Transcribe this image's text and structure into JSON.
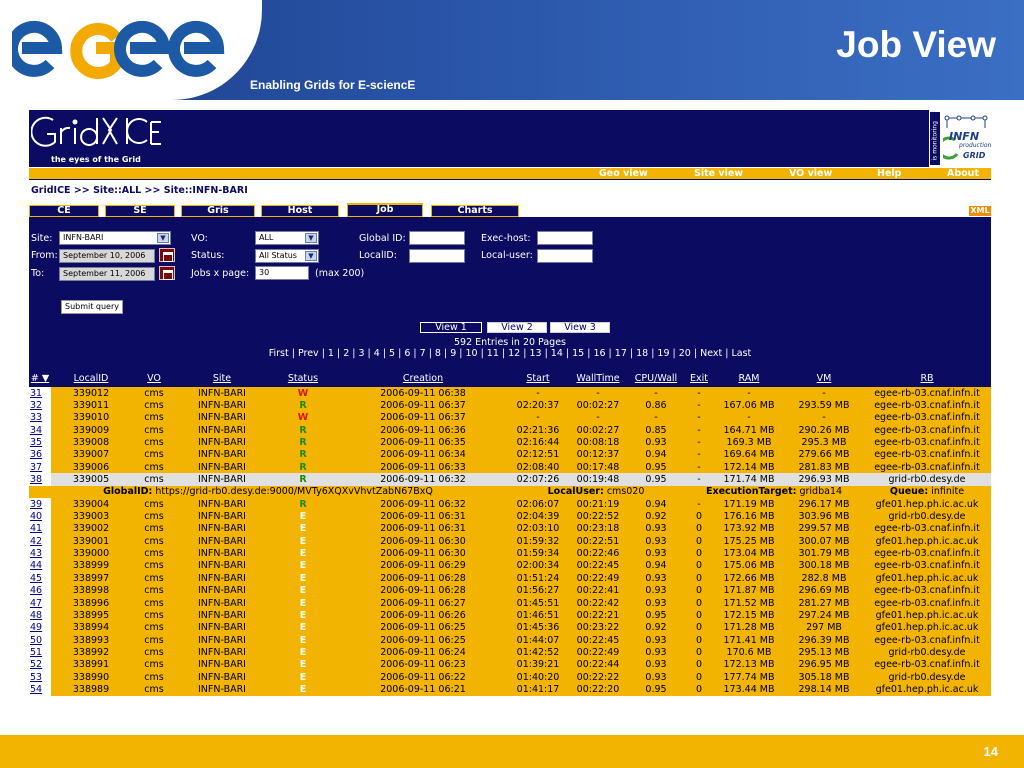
{
  "slide": {
    "title": "Job View",
    "subtitle": "Enabling Grids for E-sciencE",
    "page_number": "14",
    "logo_text": "egee",
    "colors": {
      "header_blue": "#1c3f8c",
      "accent_yellow": "#f2b400",
      "gridice_navy": "#0b0b61"
    }
  },
  "gridice": {
    "logo_text": "GridICE",
    "tagline": "the eyes of the Grid",
    "infn_badge": {
      "side": "is monitoring",
      "line1": "INFN",
      "line2": "production",
      "line3": "GRID"
    },
    "nav": [
      "Geo view",
      "Site view",
      "VO view",
      "Help",
      "About"
    ],
    "breadcrumb": "GridICE >> Site::ALL >> Site::INFN-BARI",
    "tabs": [
      "CE",
      "SE",
      "Gris",
      "Host",
      "Job",
      "Charts"
    ],
    "active_tab": "Job",
    "xml_label": "XML",
    "form": {
      "site_label": "Site:",
      "site_value": "INFN-BARI",
      "from_label": "From:",
      "from_value": "September 10, 2006",
      "to_label": "To:",
      "to_value": "September 11, 2006",
      "vo_label": "VO:",
      "vo_value": "ALL",
      "status_label": "Status:",
      "status_value": "All Status",
      "jobs_label": "Jobs x page:",
      "jobs_value": "30",
      "jobs_max": "(max 200)",
      "global_id_label": "Global ID:",
      "global_id_value": "",
      "localid_label": "LocalID:",
      "localid_value": "",
      "exec_host_label": "Exec-host:",
      "exec_host_value": "",
      "local_user_label": "Local-user:",
      "local_user_value": "",
      "submit": "Submit query"
    },
    "views": [
      "View 1",
      "View 2",
      "View 3"
    ],
    "entries": "592 Entries in 20 Pages",
    "pager": "First | Prev | 1 | 2 | 3 | 4 | 5 | 6 | 7 | 8 | 9 | 10 | 11 | 12 | 13 | 14 | 15 | 16 | 17 | 18 | 19 | 20 | Next | Last",
    "columns": [
      "# ▼",
      "LocalID",
      "VO",
      "Site",
      "Status",
      "Creation",
      "Start",
      "WallTime",
      "CPU/Wall",
      "Exit",
      "RAM",
      "VM",
      "RB"
    ],
    "rows": [
      {
        "n": "31",
        "id": "339012",
        "vo": "cms",
        "site": "INFN-BARI",
        "status": "W",
        "creation": "2006-09-11 06:38",
        "start": "-",
        "wall": "-",
        "cpu": "-",
        "exit": "-",
        "ram": "-",
        "vm": "-",
        "rb": "egee-rb-03.cnaf.infn.it"
      },
      {
        "n": "32",
        "id": "339011",
        "vo": "cms",
        "site": "INFN-BARI",
        "status": "R",
        "creation": "2006-09-11 06:37",
        "start": "02:20:37",
        "wall": "00:02:27",
        "cpu": "0.86",
        "exit": "-",
        "ram": "167.06 MB",
        "vm": "293.59 MB",
        "rb": "egee-rb-03.cnaf.infn.it"
      },
      {
        "n": "33",
        "id": "339010",
        "vo": "cms",
        "site": "INFN-BARI",
        "status": "W",
        "creation": "2006-09-11 06:37",
        "start": "-",
        "wall": "-",
        "cpu": "-",
        "exit": "-",
        "ram": "-",
        "vm": "-",
        "rb": "egee-rb-03.cnaf.infn.it"
      },
      {
        "n": "34",
        "id": "339009",
        "vo": "cms",
        "site": "INFN-BARI",
        "status": "R",
        "creation": "2006-09-11 06:36",
        "start": "02:21:36",
        "wall": "00:02:27",
        "cpu": "0.85",
        "exit": "-",
        "ram": "164.71 MB",
        "vm": "290.26 MB",
        "rb": "egee-rb-03.cnaf.infn.it"
      },
      {
        "n": "35",
        "id": "339008",
        "vo": "cms",
        "site": "INFN-BARI",
        "status": "R",
        "creation": "2006-09-11 06:35",
        "start": "02:16:44",
        "wall": "00:08:18",
        "cpu": "0.93",
        "exit": "-",
        "ram": "169.3 MB",
        "vm": "295.3 MB",
        "rb": "egee-rb-03.cnaf.infn.it"
      },
      {
        "n": "36",
        "id": "339007",
        "vo": "cms",
        "site": "INFN-BARI",
        "status": "R",
        "creation": "2006-09-11 06:34",
        "start": "02:12:51",
        "wall": "00:12:37",
        "cpu": "0.94",
        "exit": "-",
        "ram": "169.64 MB",
        "vm": "279.66 MB",
        "rb": "egee-rb-03.cnaf.infn.it"
      },
      {
        "n": "37",
        "id": "339006",
        "vo": "cms",
        "site": "INFN-BARI",
        "status": "R",
        "creation": "2006-09-11 06:33",
        "start": "02:08:40",
        "wall": "00:17:48",
        "cpu": "0.95",
        "exit": "-",
        "ram": "172.14 MB",
        "vm": "281.83 MB",
        "rb": "egee-rb-03.cnaf.infn.it"
      },
      {
        "n": "38",
        "id": "339005",
        "vo": "cms",
        "site": "INFN-BARI",
        "status": "R",
        "creation": "2006-09-11 06:32",
        "start": "02:07:26",
        "wall": "00:19:48",
        "cpu": "0.95",
        "exit": "-",
        "ram": "171.74 MB",
        "vm": "296.93 MB",
        "rb": "grid-rb0.desy.de",
        "selected": true
      },
      {
        "n": "39",
        "id": "339004",
        "vo": "cms",
        "site": "INFN-BARI",
        "status": "R",
        "creation": "2006-09-11 06:32",
        "start": "02:06:07",
        "wall": "00:21:19",
        "cpu": "0.94",
        "exit": "-",
        "ram": "171.19 MB",
        "vm": "296.17 MB",
        "rb": "gfe01.hep.ph.ic.ac.uk"
      },
      {
        "n": "40",
        "id": "339003",
        "vo": "cms",
        "site": "INFN-BARI",
        "status": "E",
        "creation": "2006-09-11 06:31",
        "start": "02:04:39",
        "wall": "00:22:52",
        "cpu": "0.92",
        "exit": "0",
        "ram": "176.16 MB",
        "vm": "303.96 MB",
        "rb": "grid-rb0.desy.de"
      },
      {
        "n": "41",
        "id": "339002",
        "vo": "cms",
        "site": "INFN-BARI",
        "status": "E",
        "creation": "2006-09-11 06:31",
        "start": "02:03:10",
        "wall": "00:23:18",
        "cpu": "0.93",
        "exit": "0",
        "ram": "173.92 MB",
        "vm": "299.57 MB",
        "rb": "egee-rb-03.cnaf.infn.it"
      },
      {
        "n": "42",
        "id": "339001",
        "vo": "cms",
        "site": "INFN-BARI",
        "status": "E",
        "creation": "2006-09-11 06:30",
        "start": "01:59:32",
        "wall": "00:22:51",
        "cpu": "0.93",
        "exit": "0",
        "ram": "175.25 MB",
        "vm": "300.07 MB",
        "rb": "gfe01.hep.ph.ic.ac.uk"
      },
      {
        "n": "43",
        "id": "339000",
        "vo": "cms",
        "site": "INFN-BARI",
        "status": "E",
        "creation": "2006-09-11 06:30",
        "start": "01:59:34",
        "wall": "00:22:46",
        "cpu": "0.93",
        "exit": "0",
        "ram": "173.04 MB",
        "vm": "301.79 MB",
        "rb": "egee-rb-03.cnaf.infn.it"
      },
      {
        "n": "44",
        "id": "338999",
        "vo": "cms",
        "site": "INFN-BARI",
        "status": "E",
        "creation": "2006-09-11 06:29",
        "start": "02:00:34",
        "wall": "00:22:45",
        "cpu": "0.94",
        "exit": "0",
        "ram": "175.06 MB",
        "vm": "300.18 MB",
        "rb": "egee-rb-03.cnaf.infn.it"
      },
      {
        "n": "45",
        "id": "338997",
        "vo": "cms",
        "site": "INFN-BARI",
        "status": "E",
        "creation": "2006-09-11 06:28",
        "start": "01:51:24",
        "wall": "00:22:49",
        "cpu": "0.93",
        "exit": "0",
        "ram": "172.66 MB",
        "vm": "282.8 MB",
        "rb": "gfe01.hep.ph.ic.ac.uk"
      },
      {
        "n": "46",
        "id": "338998",
        "vo": "cms",
        "site": "INFN-BARI",
        "status": "E",
        "creation": "2006-09-11 06:28",
        "start": "01:56:27",
        "wall": "00:22:41",
        "cpu": "0.93",
        "exit": "0",
        "ram": "171.87 MB",
        "vm": "296.69 MB",
        "rb": "egee-rb-03.cnaf.infn.it"
      },
      {
        "n": "47",
        "id": "338996",
        "vo": "cms",
        "site": "INFN-BARI",
        "status": "E",
        "creation": "2006-09-11 06:27",
        "start": "01:45:51",
        "wall": "00:22:42",
        "cpu": "0.93",
        "exit": "0",
        "ram": "171.52 MB",
        "vm": "281.27 MB",
        "rb": "egee-rb-03.cnaf.infn.it"
      },
      {
        "n": "48",
        "id": "338995",
        "vo": "cms",
        "site": "INFN-BARI",
        "status": "E",
        "creation": "2006-09-11 06:26",
        "start": "01:46:51",
        "wall": "00:22:21",
        "cpu": "0.95",
        "exit": "0",
        "ram": "172.15 MB",
        "vm": "297.24 MB",
        "rb": "gfe01.hep.ph.ic.ac.uk"
      },
      {
        "n": "49",
        "id": "338994",
        "vo": "cms",
        "site": "INFN-BARI",
        "status": "E",
        "creation": "2006-09-11 06:25",
        "start": "01:45:36",
        "wall": "00:23:22",
        "cpu": "0.92",
        "exit": "0",
        "ram": "171.28 MB",
        "vm": "297 MB",
        "rb": "gfe01.hep.ph.ic.ac.uk"
      },
      {
        "n": "50",
        "id": "338993",
        "vo": "cms",
        "site": "INFN-BARI",
        "status": "E",
        "creation": "2006-09-11 06:25",
        "start": "01:44:07",
        "wall": "00:22:45",
        "cpu": "0.93",
        "exit": "0",
        "ram": "171.41 MB",
        "vm": "296.39 MB",
        "rb": "egee-rb-03.cnaf.infn.it"
      },
      {
        "n": "51",
        "id": "338992",
        "vo": "cms",
        "site": "INFN-BARI",
        "status": "E",
        "creation": "2006-09-11 06:24",
        "start": "01:42:52",
        "wall": "00:22:49",
        "cpu": "0.93",
        "exit": "0",
        "ram": "170.6 MB",
        "vm": "295.13 MB",
        "rb": "grid-rb0.desy.de"
      },
      {
        "n": "52",
        "id": "338991",
        "vo": "cms",
        "site": "INFN-BARI",
        "status": "E",
        "creation": "2006-09-11 06:23",
        "start": "01:39:21",
        "wall": "00:22:44",
        "cpu": "0.93",
        "exit": "0",
        "ram": "172.13 MB",
        "vm": "296.95 MB",
        "rb": "egee-rb-03.cnaf.infn.it"
      },
      {
        "n": "53",
        "id": "338990",
        "vo": "cms",
        "site": "INFN-BARI",
        "status": "E",
        "creation": "2006-09-11 06:22",
        "start": "01:40:20",
        "wall": "00:22:22",
        "cpu": "0.93",
        "exit": "0",
        "ram": "177.74 MB",
        "vm": "305.18 MB",
        "rb": "grid-rb0.desy.de"
      },
      {
        "n": "54",
        "id": "338989",
        "vo": "cms",
        "site": "INFN-BARI",
        "status": "E",
        "creation": "2006-09-11 06:21",
        "start": "01:41:17",
        "wall": "00:22:20",
        "cpu": "0.95",
        "exit": "0",
        "ram": "173.44 MB",
        "vm": "298.14 MB",
        "rb": "gfe01.hep.ph.ic.ac.uk"
      }
    ],
    "detail": {
      "after_row": "38",
      "global_label": "GlobalID:",
      "global_value": "https://grid-rb0.desy.de:9000/MVTy6XQXvVhvtZabN67BxQ",
      "localuser_label": "LocalUser:",
      "localuser_value": "cms020",
      "exec_label": "ExecutionTarget:",
      "exec_value": "gridba14",
      "queue_label": "Queue:",
      "queue_value": "infinite"
    }
  }
}
